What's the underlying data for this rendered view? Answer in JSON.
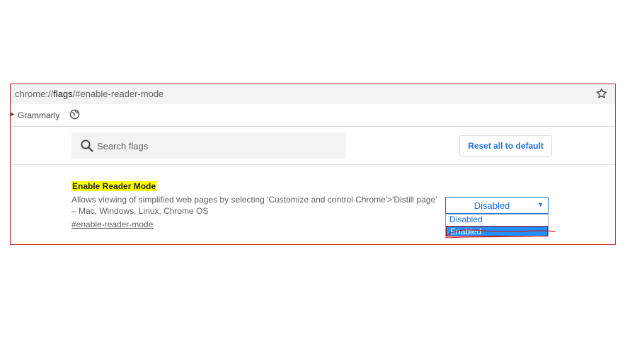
{
  "address_bar": {
    "scheme": "chrome://",
    "host": "flags",
    "path": "/#enable-reader-mode"
  },
  "bookmarks": {
    "items": [
      {
        "label": "Grammarly",
        "icon": "grammarly-bookmark"
      },
      {
        "label": "",
        "icon": "globe-icon"
      }
    ]
  },
  "toolbar": {
    "search_placeholder": "Search flags",
    "reset_label": "Reset all to default"
  },
  "flag": {
    "title": "Enable Reader Mode",
    "description": "Allows viewing of simplified web pages by selecting 'Customize and control Chrome'>'Distill page' – Mac, Windows, Linux, Chrome OS",
    "link": "#enable-reader-mode",
    "select": {
      "selected": "Disabled",
      "options": [
        "Disabled",
        "Enabled"
      ],
      "highlighted": "Enabled"
    }
  },
  "colors": {
    "accent": "#1a73e8",
    "highlight": "#ffff00",
    "annotation": "#cc2222",
    "option_highlight": "#1e90ff"
  }
}
